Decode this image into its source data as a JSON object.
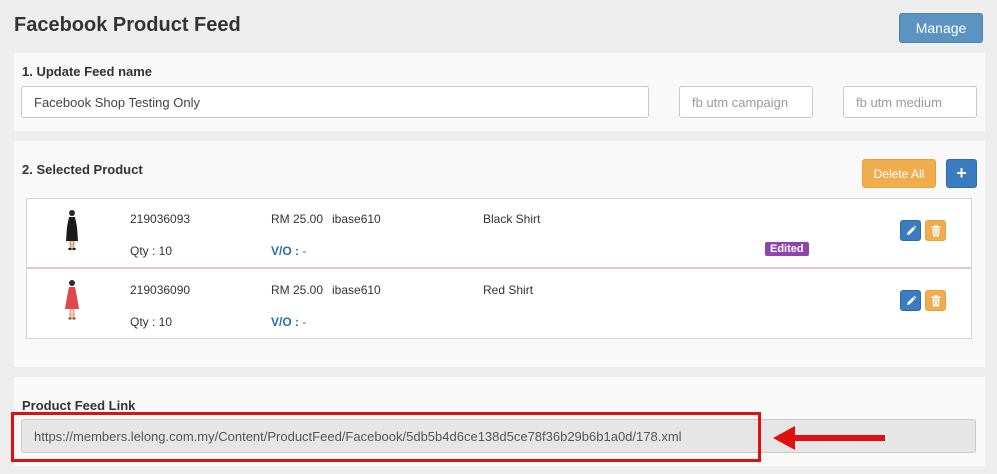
{
  "header": {
    "title": "Facebook Product Feed",
    "manage_label": "Manage"
  },
  "feed_name": {
    "section_label": "1. Update Feed name",
    "name_value": "Facebook Shop Testing Only",
    "utm_campaign_placeholder": "fb utm campaign",
    "utm_medium_placeholder": "fb utm medium"
  },
  "selected_product": {
    "section_label": "2. Selected Product",
    "delete_all_label": "Delete All",
    "add_label": "+",
    "products": [
      {
        "id": "219036093",
        "qty": "Qty : 10",
        "price": "RM 25.00",
        "seller": "ibase610",
        "vo_label": "V/O :",
        "vo_value": " -",
        "name": "Black Shirt",
        "badge": "Edited",
        "thumb_color": "#1a1a1a"
      },
      {
        "id": "219036090",
        "qty": "Qty : 10",
        "price": "RM 25.00",
        "seller": "ibase610",
        "vo_label": "V/O :",
        "vo_value": " -",
        "name": "Red Shirt",
        "badge": "",
        "thumb_color": "#e0474c"
      }
    ]
  },
  "feed_link": {
    "section_label": "Product Feed Link",
    "url": "https://members.lelong.com.my/Content/ProductFeed/Facebook/5db5b4d6ce138d5ce78f36b29b6b1a0d/178.xml"
  },
  "colors": {
    "primary": "#3b7bbf",
    "warning": "#f0ad4e",
    "badge": "#8e44ad",
    "highlight": "#e01010"
  }
}
